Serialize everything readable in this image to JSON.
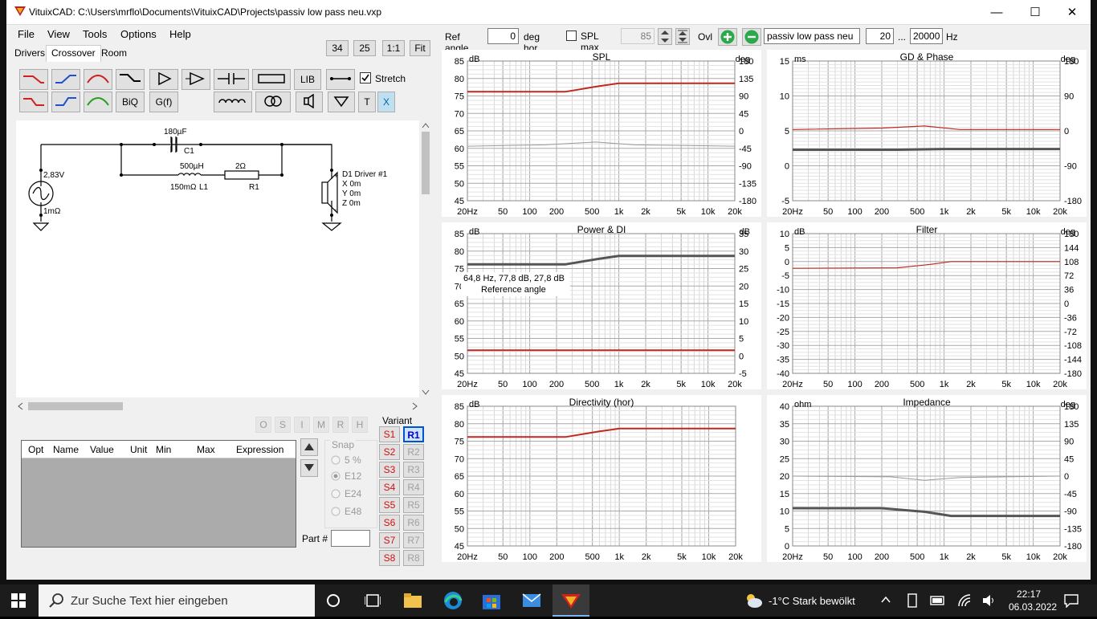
{
  "window": {
    "title": "VituixCAD: C:\\Users\\mrflo\\Documents\\VituixCAD\\Projects\\passiv low pass neu.vxp"
  },
  "menu": [
    "File",
    "View",
    "Tools",
    "Options",
    "Help"
  ],
  "tabs": [
    "Drivers",
    "Crossover",
    "Room"
  ],
  "zoom_buttons": [
    "34",
    "25",
    "1:1",
    "Fit"
  ],
  "tools": {
    "lib": "LIB",
    "biq": "BiQ",
    "gf": "G(f)",
    "t": "T",
    "x": "X",
    "stretch": "Stretch"
  },
  "schematic": {
    "cap_value": "180µF",
    "cap_name": "C1",
    "ind_value": "500µH",
    "ind_res": "150mΩ",
    "ind_name": "L1",
    "res_value": "2Ω",
    "res_name": "R1",
    "source_voltage": "2,83V",
    "source_res": "1mΩ",
    "driver_name": "D1 Driver #1",
    "driver_x": "X 0m",
    "driver_y": "Y 0m",
    "driver_z": "Z 0m"
  },
  "opt_buttons": [
    "O",
    "S",
    "I",
    "M",
    "R",
    "H"
  ],
  "param_table": {
    "columns": [
      "Opt",
      "Name",
      "Value",
      "Unit",
      "Min",
      "Max",
      "Expression"
    ]
  },
  "snap": {
    "label": "Snap",
    "options": [
      "5 %",
      "E12",
      "E24",
      "E48"
    ],
    "selected": "E12"
  },
  "part_label": "Part #",
  "variant": {
    "label": "Variant",
    "s": [
      "S1",
      "S2",
      "S3",
      "S4",
      "S5",
      "S6",
      "S7",
      "S8"
    ],
    "r": [
      "R1",
      "R2",
      "R3",
      "R4",
      "R5",
      "R6",
      "R7",
      "R8"
    ],
    "active": "R1"
  },
  "top": {
    "ref_angle_label": "Ref angle",
    "ref_angle": "0",
    "deg_hor": "deg hor",
    "spl_max_label": "SPL max",
    "spl_max": "85",
    "ovl": "Ovl",
    "project": "passiv low pass neu",
    "f_min": "20",
    "dots": "...",
    "f_max": "20000",
    "hz": "Hz"
  },
  "xticks": [
    "20Hz",
    "50",
    "100",
    "200",
    "500",
    "1k",
    "2k",
    "5k",
    "10k",
    "20k"
  ],
  "graphs": [
    {
      "title": "SPL",
      "lunit": "dB",
      "runit": "deg",
      "left": [
        "85",
        "80",
        "75",
        "70",
        "65",
        "60",
        "55",
        "50",
        "45"
      ],
      "right": [
        "180",
        "135",
        "90",
        "45",
        "0",
        "-45",
        "-90",
        "-135",
        "-180"
      ]
    },
    {
      "title": "GD & Phase",
      "lunit": "ms",
      "runit": "deg",
      "left": [
        "15",
        "10",
        "5",
        "0",
        "-5"
      ],
      "right": [
        "180",
        "90",
        "0",
        "-90",
        "-180"
      ]
    },
    {
      "title": "Power & DI",
      "lunit": "dB",
      "runit": "dB",
      "left": [
        "85",
        "80",
        "75",
        "70",
        "65",
        "60",
        "55",
        "50",
        "45"
      ],
      "right": [
        "35",
        "30",
        "25",
        "20",
        "15",
        "10",
        "5",
        "0",
        "-5"
      ]
    },
    {
      "title": "Filter",
      "lunit": "dB",
      "runit": "deg",
      "left": [
        "10",
        "5",
        "0",
        "-5",
        "-10",
        "-15",
        "-20",
        "-25",
        "-30",
        "-35",
        "-40"
      ],
      "right": [
        "180",
        "144",
        "108",
        "72",
        "36",
        "0",
        "-36",
        "-72",
        "-108",
        "-144",
        "-180"
      ]
    },
    {
      "title": "Directivity (hor)",
      "lunit": "dB",
      "runit": "",
      "left": [
        "85",
        "80",
        "75",
        "70",
        "65",
        "60",
        "55",
        "50",
        "45"
      ],
      "right": []
    },
    {
      "title": "Impedance",
      "lunit": "ohm",
      "runit": "deg",
      "left": [
        "40",
        "35",
        "30",
        "25",
        "20",
        "15",
        "10",
        "5",
        "0"
      ],
      "right": [
        "180",
        "135",
        "90",
        "45",
        "0",
        "-45",
        "-90",
        "-135",
        "-180"
      ]
    }
  ],
  "tooltip": {
    "line1": "64,8 Hz, 77,8 dB, 27,8 dB",
    "line2": "Reference angle"
  },
  "taskbar": {
    "search": "Zur Suche Text hier eingeben",
    "weather": "-1°C  Stark bewölkt",
    "time": "22:17",
    "date": "06.03.2022"
  },
  "colors": {
    "red": "#c0281e",
    "dark": "#555555",
    "grey": "#9a9a9a"
  }
}
